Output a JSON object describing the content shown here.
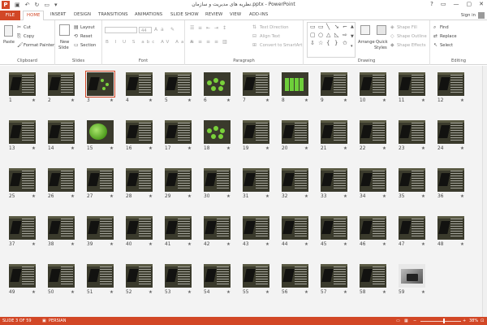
{
  "window": {
    "title": "نظریه های مدیریت و سازمان.pptx - PowerPoint",
    "app_icon_letter": "P",
    "controls": [
      "?",
      "▭",
      "—",
      "▢",
      "✕"
    ]
  },
  "ribbon_tabs": [
    "FILE",
    "HOME",
    "INSERT",
    "DESIGN",
    "TRANSITIONS",
    "ANIMATIONS",
    "SLIDE SHOW",
    "REVIEW",
    "VIEW",
    "ADD-INS"
  ],
  "active_tab": "HOME",
  "sign_in": "Sign in",
  "clipboard": {
    "paste": "Paste",
    "cut": "Cut",
    "copy": "Copy",
    "format_painter": "Format Painter",
    "label": "Clipboard"
  },
  "slides_group": {
    "new_slide": "New",
    "new_slide2": "Slide",
    "layout": "Layout",
    "reset": "Reset",
    "section": "Section",
    "label": "Slides"
  },
  "font_group": {
    "size": "44",
    "label": "Font",
    "format_row": "B I U S abc AV Aa A"
  },
  "paragraph_group": {
    "text_direction": "Text Direction",
    "align_text": "Align Text",
    "convert_smartart": "Convert to SmartArt",
    "label": "Paragraph"
  },
  "drawing_group": {
    "arrange": "Arrange",
    "quick_styles": "Quick",
    "quick_styles2": "Styles",
    "shape_fill": "Shape Fill",
    "shape_outline": "Shape Outline",
    "shape_effects": "Shape Effects",
    "label": "Drawing"
  },
  "editing_group": {
    "find": "Find",
    "replace": "Replace",
    "select": "Select",
    "label": "Editing"
  },
  "slides": [
    {
      "n": "1",
      "v": "text"
    },
    {
      "n": "2",
      "v": "text"
    },
    {
      "n": "3",
      "v": "dark",
      "selected": true
    },
    {
      "n": "4",
      "v": "text"
    },
    {
      "n": "5",
      "v": "text"
    },
    {
      "n": "6",
      "v": "g"
    },
    {
      "n": "7",
      "v": "text"
    },
    {
      "n": "8",
      "v": "grid"
    },
    {
      "n": "9",
      "v": "text"
    },
    {
      "n": "10",
      "v": "text"
    },
    {
      "n": "11",
      "v": "text"
    },
    {
      "n": "12",
      "v": "text"
    },
    {
      "n": "13",
      "v": "text"
    },
    {
      "n": "14",
      "v": "text"
    },
    {
      "n": "15",
      "v": "ball"
    },
    {
      "n": "16",
      "v": "text"
    },
    {
      "n": "17",
      "v": "text"
    },
    {
      "n": "18",
      "v": "g"
    },
    {
      "n": "19",
      "v": "text"
    },
    {
      "n": "20",
      "v": "text"
    },
    {
      "n": "21",
      "v": "text"
    },
    {
      "n": "22",
      "v": "text"
    },
    {
      "n": "23",
      "v": "text"
    },
    {
      "n": "24",
      "v": "text"
    },
    {
      "n": "25",
      "v": "text"
    },
    {
      "n": "26",
      "v": "text"
    },
    {
      "n": "27",
      "v": "text"
    },
    {
      "n": "28",
      "v": "text"
    },
    {
      "n": "29",
      "v": "text"
    },
    {
      "n": "30",
      "v": "text"
    },
    {
      "n": "31",
      "v": "text"
    },
    {
      "n": "32",
      "v": "text"
    },
    {
      "n": "33",
      "v": "text"
    },
    {
      "n": "34",
      "v": "text"
    },
    {
      "n": "35",
      "v": "text"
    },
    {
      "n": "36",
      "v": "text"
    },
    {
      "n": "37",
      "v": "text"
    },
    {
      "n": "38",
      "v": "text"
    },
    {
      "n": "39",
      "v": "text"
    },
    {
      "n": "40",
      "v": "text"
    },
    {
      "n": "41",
      "v": "text"
    },
    {
      "n": "42",
      "v": "text"
    },
    {
      "n": "43",
      "v": "text"
    },
    {
      "n": "44",
      "v": "text"
    },
    {
      "n": "45",
      "v": "text"
    },
    {
      "n": "46",
      "v": "text"
    },
    {
      "n": "47",
      "v": "text"
    },
    {
      "n": "48",
      "v": "text"
    },
    {
      "n": "49",
      "v": "text"
    },
    {
      "n": "50",
      "v": "text"
    },
    {
      "n": "51",
      "v": "text"
    },
    {
      "n": "52",
      "v": "text"
    },
    {
      "n": "53",
      "v": "text"
    },
    {
      "n": "54",
      "v": "text"
    },
    {
      "n": "55",
      "v": "text"
    },
    {
      "n": "56",
      "v": "text"
    },
    {
      "n": "57",
      "v": "text"
    },
    {
      "n": "58",
      "v": "text"
    },
    {
      "n": "59",
      "v": "photo"
    }
  ],
  "transition_mark": "★",
  "status": {
    "slide_info": "SLIDE 3 OF 59",
    "language": "PERSIAN",
    "zoom": "38%"
  },
  "colors": {
    "accent": "#d24726",
    "sorter_bg": "#f3f3f3"
  }
}
